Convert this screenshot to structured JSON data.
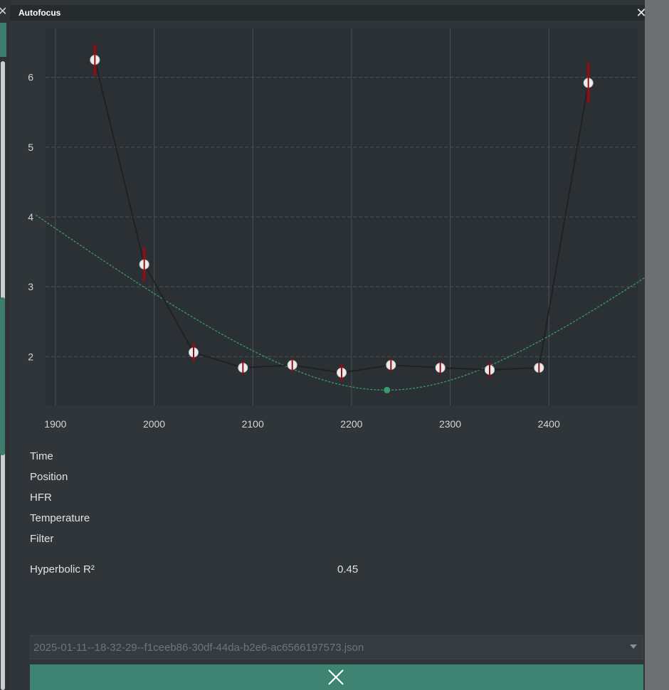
{
  "window": {
    "title": "Autofocus",
    "close_icon": "close-icon"
  },
  "colors": {
    "accent": "#3f8472",
    "fit_curve": "#3a9a6e",
    "error_bar": "#8b0f14",
    "point": "#ececec"
  },
  "chart_data": {
    "type": "scatter",
    "x": [
      1940,
      1990,
      2040,
      2090,
      2140,
      2190,
      2240,
      2290,
      2340,
      2390,
      2440
    ],
    "y": [
      6.25,
      3.32,
      2.06,
      1.84,
      1.88,
      1.77,
      1.88,
      1.84,
      1.81,
      1.84,
      5.92
    ],
    "error": [
      0.22,
      0.24,
      0.13,
      0.09,
      0.09,
      0.12,
      0.09,
      0.08,
      0.1,
      0.07,
      0.29
    ],
    "fit_curve": {
      "type": "hyperbolic",
      "minimum": {
        "x": 2236,
        "y": 1.52
      }
    },
    "xticks": [
      "1900",
      "2000",
      "2100",
      "2200",
      "2300",
      "2400"
    ],
    "yticks": [
      "2",
      "3",
      "4",
      "5",
      "6"
    ],
    "xlim": [
      1890,
      2490
    ],
    "ylim": [
      1.3,
      6.7
    ],
    "grid": true,
    "xlabel": "",
    "ylabel": ""
  },
  "info": {
    "time_label": "Time",
    "position_label": "Position",
    "hfr_label": "HFR",
    "temperature_label": "Temperature",
    "filter_label": "Filter",
    "r2_label": "Hyperbolic R²",
    "r2_value": "0.45"
  },
  "file_select": {
    "value": "2025-01-11--18-32-29--f1ceeb86-30df-44da-b2e6-ac6566197573.json",
    "icon": "chevron-down-icon"
  },
  "clear_button": {
    "icon": "close-icon"
  }
}
